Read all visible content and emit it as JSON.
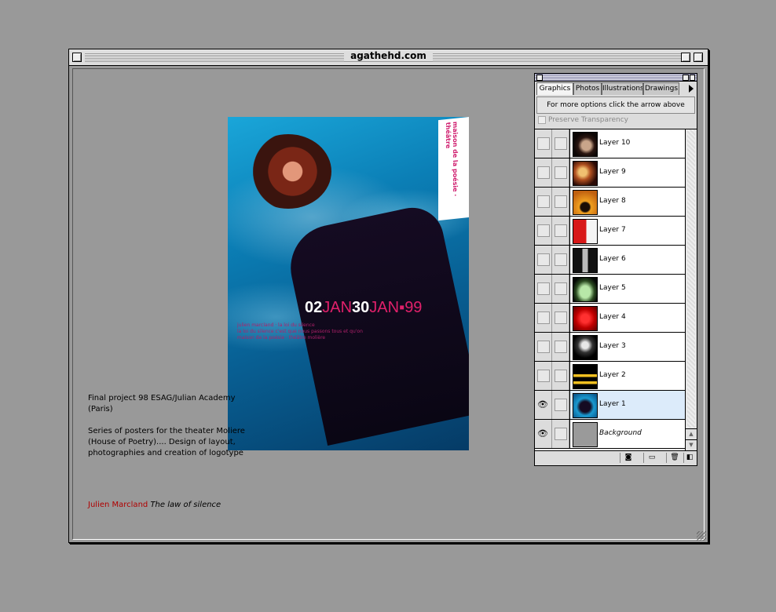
{
  "window": {
    "title": "agathehd.com"
  },
  "poster": {
    "date_day1": "02",
    "date_month1": "JAN",
    "date_day2": "30",
    "date_month2": "JAN",
    "date_year": "99",
    "fine_line1": "julien marcland · la loi du silence",
    "fine_line2": "la loi du silence c'est que nous passons tous et qu'on",
    "fine_line3": "maison de la poésie · théâtre molière",
    "strip_text": "maison de la poésie · théâtre"
  },
  "description": {
    "paragraph1": "Final project 98 ESAG/Julian Academy (Paris)",
    "paragraph2": "Series of posters for the theater Moliere (House of Poetry).... Design of layout, photographies and creation of logotype"
  },
  "credit": {
    "author": "Julien Marcland",
    "work": "The law of silence"
  },
  "palette": {
    "tabs": [
      "Graphics",
      "Photos",
      "Illustrations",
      "Drawings"
    ],
    "active_tab": "Graphics",
    "message": "For more options click the arrow above",
    "preserve_label": "Preserve Transparency",
    "layers": [
      {
        "name": "Layer 10",
        "visible": false,
        "selected": false
      },
      {
        "name": "Layer 9",
        "visible": false,
        "selected": false
      },
      {
        "name": "Layer 8",
        "visible": false,
        "selected": false
      },
      {
        "name": "Layer 7",
        "visible": false,
        "selected": false
      },
      {
        "name": "Layer 6",
        "visible": false,
        "selected": false
      },
      {
        "name": "Layer 5",
        "visible": false,
        "selected": false
      },
      {
        "name": "Layer 4",
        "visible": false,
        "selected": false
      },
      {
        "name": "Layer 3",
        "visible": false,
        "selected": false
      },
      {
        "name": "Layer 2",
        "visible": false,
        "selected": false
      },
      {
        "name": "Layer 1",
        "visible": true,
        "selected": true
      },
      {
        "name": "Background",
        "visible": true,
        "selected": false
      }
    ],
    "colors": {
      "selected_row": "#dcebfa",
      "accent_pink": "#e0206a",
      "credit_red": "#b00000"
    }
  }
}
